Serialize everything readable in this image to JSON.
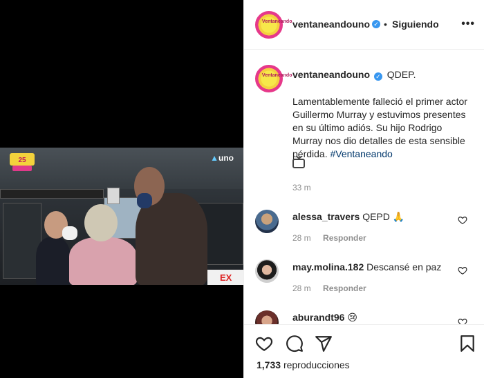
{
  "video": {
    "logo_right": "uno",
    "sign_text": "EX"
  },
  "post": {
    "username": "ventaneandouno",
    "verified_mark": "✓",
    "separator": "•",
    "follow_label": "Siguiendo",
    "more_label": "•••",
    "avatar_text": "Ventaneando",
    "caption": {
      "lead": "QDEP.",
      "body": "Lamentablemente falleció el primer actor Guillermo Murray y estuvimos presentes en su último adiós. Su hijo Rodrigo Murray nos dio detalles de esta sensible pérdida.",
      "hashtag": "#Ventaneando",
      "emoji_icon": "television-icon",
      "time": "33 m"
    },
    "comments": [
      {
        "user": "alessa_travers",
        "text": "QEPD",
        "emoji": "🙏",
        "time": "28 m",
        "reply": "Responder"
      },
      {
        "user": "may.molina.182",
        "text": "Descansé en paz",
        "emoji": "",
        "time": "28 m",
        "reply": "Responder"
      },
      {
        "user": "aburandt96",
        "text": "",
        "emoji": "😢",
        "time": "",
        "reply": ""
      }
    ],
    "actions": {
      "like_icon": "heart-icon",
      "comment_icon": "comment-icon",
      "share_icon": "paper-plane-icon",
      "save_icon": "bookmark-icon"
    },
    "views_count": "1,733",
    "views_label": "reproducciones"
  },
  "colors": {
    "accent_blue": "#3897f0",
    "hashtag": "#00376b",
    "muted": "#8e8e8e",
    "brand_pink": "#e6398a",
    "brand_yellow": "#f7e84a"
  }
}
